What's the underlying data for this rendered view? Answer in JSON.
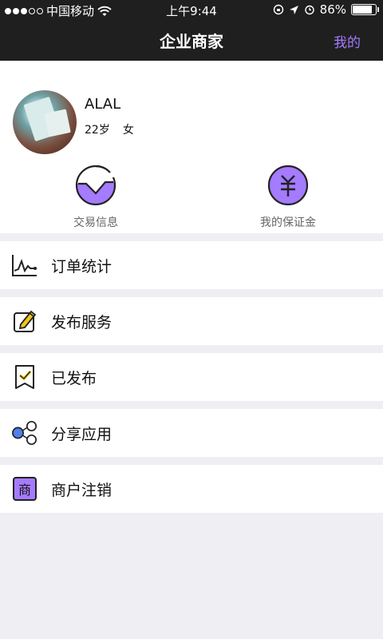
{
  "status_bar": {
    "carrier": "中国移动",
    "time": "上午9:44",
    "battery": "86%"
  },
  "nav": {
    "title": "企业商家",
    "right_label": "我的"
  },
  "profile": {
    "name": "ALAL",
    "age": "22岁",
    "gender": "女"
  },
  "quick_actions": [
    {
      "label": "交易信息",
      "icon": "wave-circle-icon"
    },
    {
      "label": "我的保证金",
      "icon": "yuan-circle-icon"
    }
  ],
  "menu": [
    {
      "label": "订单统计",
      "icon": "chart-icon"
    },
    {
      "label": "发布服务",
      "icon": "pencil-edit-icon"
    },
    {
      "label": "已发布",
      "icon": "checkmark-badge-icon"
    },
    {
      "label": "分享应用",
      "icon": "share-bubbles-icon"
    },
    {
      "label": "商户注销",
      "icon": "merchant-icon"
    }
  ],
  "merchant_icon_text": "商",
  "colors": {
    "accent": "#a57bff",
    "topbar": "#1f1f1f",
    "background": "#efeef3"
  }
}
